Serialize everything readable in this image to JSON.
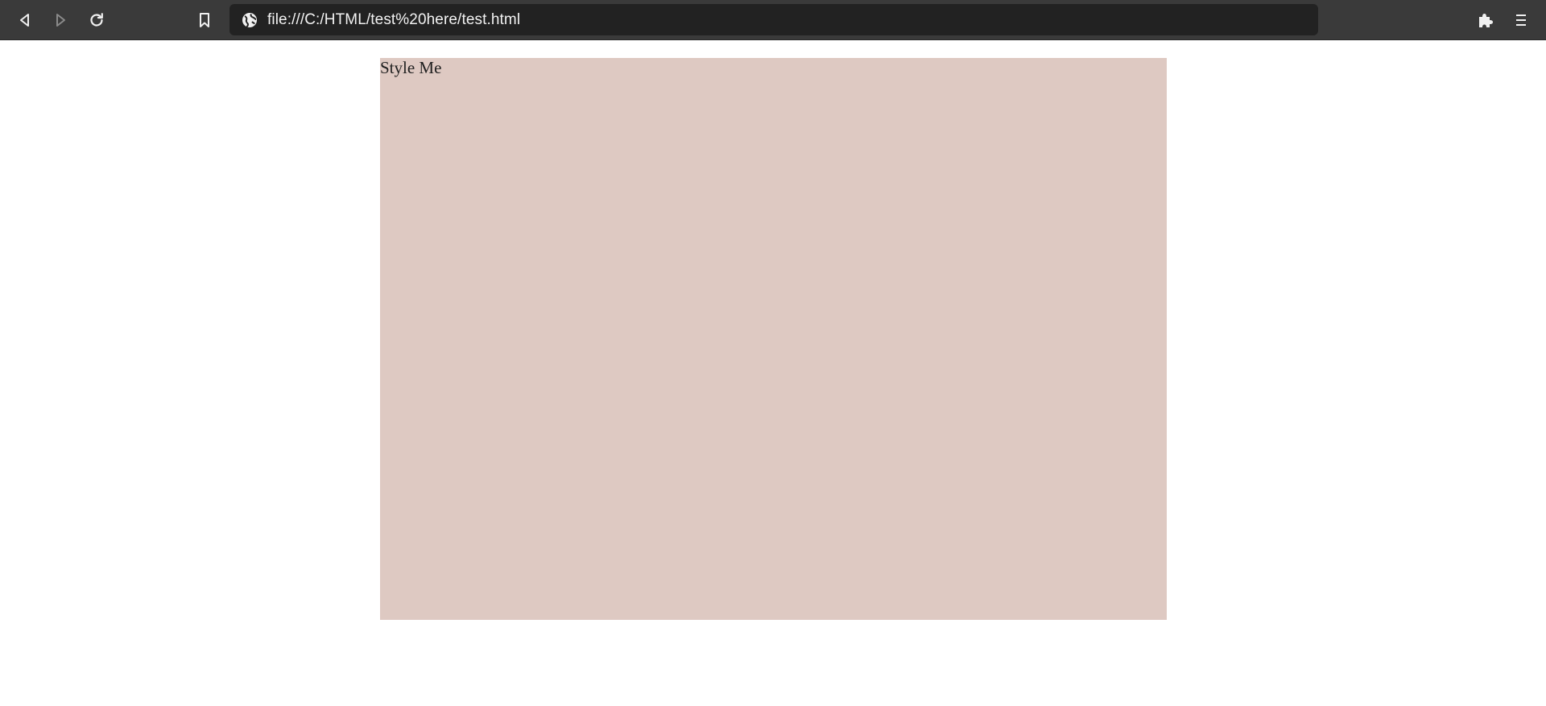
{
  "browser": {
    "url": "file:///C:/HTML/test%20here/test.html",
    "icons": {
      "back": "back-arrow-icon",
      "forward": "forward-arrow-icon",
      "reload": "reload-icon",
      "bookmark": "bookmark-icon",
      "site_info": "globe-icon",
      "extensions": "puzzle-piece-icon",
      "menu": "hamburger-menu-icon"
    },
    "colors": {
      "toolbar_bg": "#3a3a3a",
      "urlbar_bg": "#222222"
    }
  },
  "page": {
    "box_text": "Style Me",
    "box_color": "#dec9c2"
  }
}
